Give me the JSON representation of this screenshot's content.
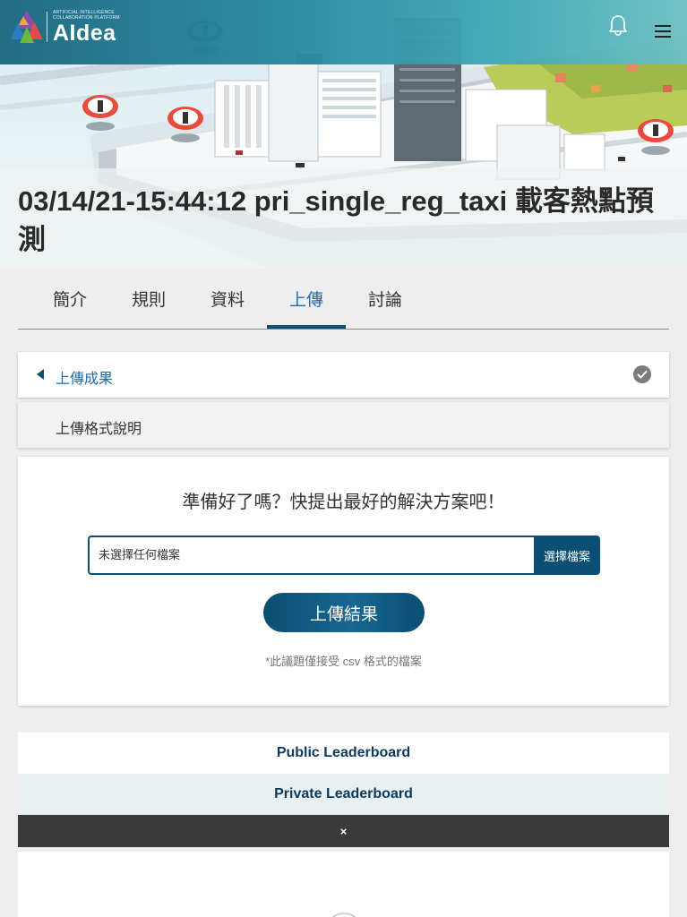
{
  "header": {
    "logo_tagline_1": "ARTIFICIAL INTELLIGENCE",
    "logo_tagline_2": "COLLABORATION PLATFORM",
    "logo_name": "AIdea"
  },
  "icons": {
    "notifications": "bell-icon",
    "menu": "hamburger-menu-icon",
    "collapse": "caret-left-icon",
    "status": "check-circle-icon",
    "close": "close-icon"
  },
  "colors": {
    "brand_dark": "#0b4f74",
    "link_blue": "#1b6bb1",
    "topbar": "#2a8ca3"
  },
  "page": {
    "title": "03/14/21-15:44:12 pri_single_reg_taxi 載客熱點預測"
  },
  "tabs": [
    {
      "label": "簡介"
    },
    {
      "label": "規則"
    },
    {
      "label": "資料"
    },
    {
      "label": "上傳",
      "active": true
    },
    {
      "label": "討論"
    }
  ],
  "accordion": {
    "upload_results": "上傳成果",
    "format_help": "上傳格式說明"
  },
  "upload": {
    "heading": "準備好了嗎？快提出最好的解決方案吧！",
    "file_placeholder": "未選擇任何檔案",
    "choose_file": "選擇檔案",
    "submit": "上傳結果",
    "note": "*此議題僅接受 csv 格式的檔案"
  },
  "leaderboard": {
    "public": "Public Leaderboard",
    "private": "Private Leaderboard",
    "close_symbol": "×"
  }
}
